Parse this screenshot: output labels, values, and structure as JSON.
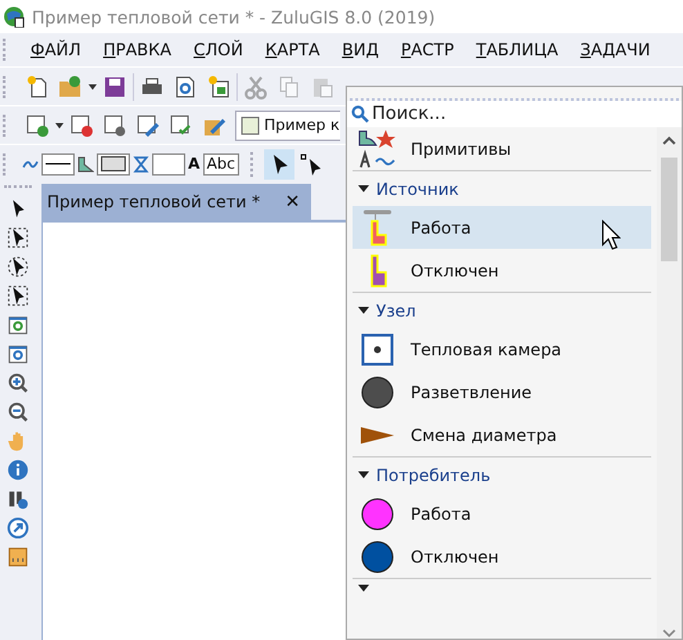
{
  "window": {
    "title": "Пример тепловой сети * - ZuluGIS 8.0 (2019)"
  },
  "menu": [
    "ФАЙЛ",
    "ПРАВКА",
    "СЛОЙ",
    "КАРТА",
    "ВИД",
    "РАСТР",
    "ТАБЛИЦА",
    "ЗАДАЧИ"
  ],
  "layer_combo": {
    "value": "Пример к"
  },
  "style_bar": {
    "text_label": "A",
    "text_sample": "Abc"
  },
  "document_tab": {
    "title": "Пример тепловой сети *",
    "close": "✕"
  },
  "palette": {
    "search": {
      "placeholder": "Поиск..."
    },
    "items": [
      {
        "kind": "primitives",
        "label": "Примитивы",
        "selected": false
      },
      {
        "kind": "header",
        "label": "Источник",
        "expanded": true
      },
      {
        "kind": "source",
        "color": "#f06060",
        "label": "Работа",
        "selected": true
      },
      {
        "kind": "source",
        "color": "#a050b0",
        "label": "Отключен",
        "selected": false
      },
      {
        "kind": "header",
        "label": "Узел",
        "expanded": true
      },
      {
        "kind": "chamber",
        "label": "Тепловая камера",
        "selected": false
      },
      {
        "kind": "circle",
        "color": "#4d4d4d",
        "label": "Разветвление",
        "selected": false
      },
      {
        "kind": "triangle",
        "color": "#a0520a",
        "label": "Смена диаметра",
        "selected": false
      },
      {
        "kind": "header",
        "label": "Потребитель",
        "expanded": true
      },
      {
        "kind": "circle",
        "color": "#ff33ff",
        "label": "Работа",
        "selected": false
      },
      {
        "kind": "circle",
        "color": "#0050a0",
        "label": "Отключен",
        "selected": false
      }
    ]
  }
}
